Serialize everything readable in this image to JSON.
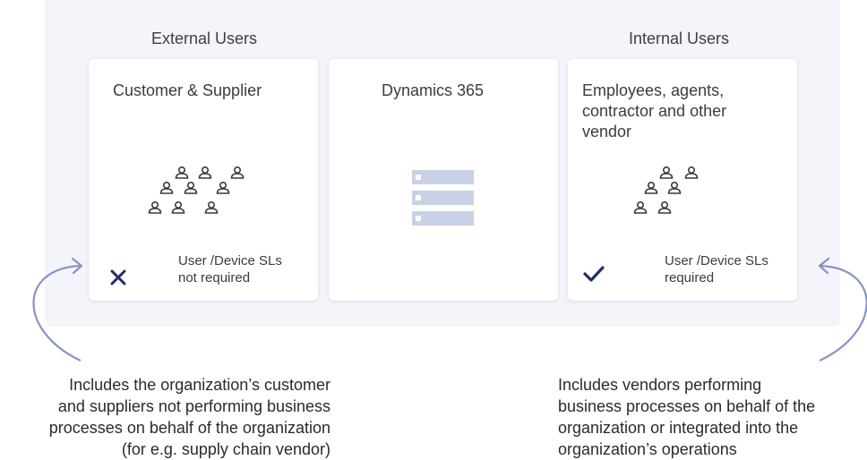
{
  "external": {
    "group_label": "External Users",
    "card_title": "Customer & Supplier",
    "status_icon": "x-icon",
    "status_text": "User /Device SLs\nnot required",
    "note": "Includes the organization’s customer\nand suppliers not performing business\nprocesses on behalf of the organization\n(for e.g. supply chain vendor)"
  },
  "center": {
    "card_title": "Dynamics 365",
    "icon": "server-stack-icon"
  },
  "internal": {
    "group_label": "Internal Users",
    "card_title": "Employees, agents,\ncontractor and other\nvendor",
    "status_icon": "checkmark-icon",
    "status_text": "User /Device SLs\nrequired",
    "note": "Includes vendors performing\nbusiness processes on behalf of the\norganization or integrated into the\norganization’s operations"
  },
  "colors": {
    "panel_bg": "#f3f5fa",
    "accent_navy": "#1f2f66",
    "arrow": "#8a93c6",
    "server_blue": "#c8d1e6"
  }
}
